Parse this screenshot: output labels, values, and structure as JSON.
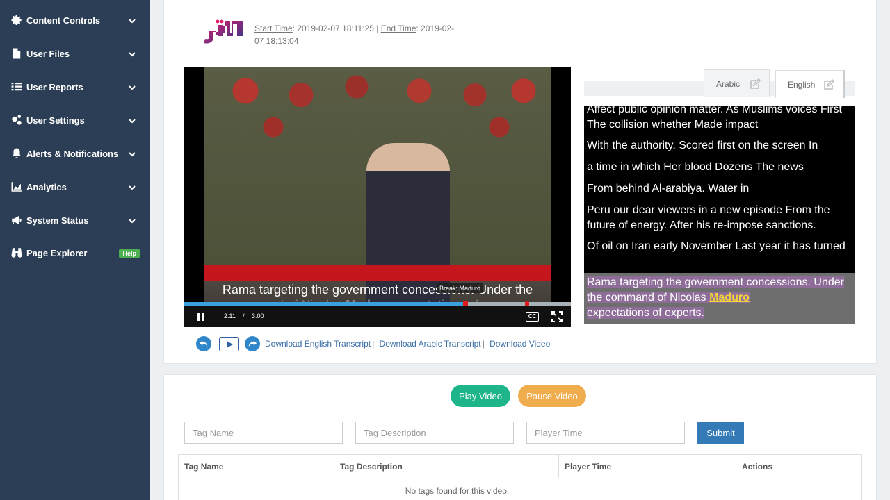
{
  "sidebar": {
    "items": [
      {
        "label": "Content Controls",
        "icon": "gear-icon"
      },
      {
        "label": "User Files",
        "icon": "file-icon"
      },
      {
        "label": "User Reports",
        "icon": "list-icon"
      },
      {
        "label": "User Settings",
        "icon": "gears-icon"
      },
      {
        "label": "Alerts & Notifications",
        "icon": "bell-icon"
      },
      {
        "label": "Analytics",
        "icon": "area-chart-icon"
      },
      {
        "label": "System Status",
        "icon": "megaphone-icon"
      },
      {
        "label": "Page Explorer",
        "icon": "binoculars-icon",
        "badge": "Help"
      }
    ]
  },
  "header": {
    "logo_text": "العربية",
    "start_label": "Start Time",
    "start_value": ": 2019-02-07 18:11:25 |",
    "end_label": "End Time",
    "end_value": ": 2019-02-07 18:13:04"
  },
  "player": {
    "subtitle_line1": "Rama targeting the government concessions. Under the",
    "subtitle_line2_a": "command of Nicolas ",
    "subtitle_line2_kw": "Maduro",
    "subtitle_line2_b": " expectations of experts.",
    "break_tooltip": "Break: Maduro",
    "current_time": "2:11",
    "time_separator": "/",
    "duration": "3:00",
    "cc_label": "CC",
    "progress_fraction": 0.728,
    "break_marker_fraction": 0.886
  },
  "links": {
    "english_transcript": "Download English Transcript",
    "arabic_transcript": "Download Arabic Transcript",
    "video": "Download Video",
    "separator": "|"
  },
  "transcript_tabs": {
    "arabic": "Arabic",
    "english": "English"
  },
  "transcript": {
    "lines": [
      "Affect public opinion matter. As Muslims voices First The collision whether Made impact",
      "With the authority. Scored first on the screen In",
      "a time in which Her blood Dozens The news",
      "From behind Al-arabiya. Water in",
      "Peru our dear viewers in a new episode From the future of energy. After his re-impose sanctions.",
      "Of oil on Iran early November Last year it has turned"
    ],
    "active_a": "Rama targeting the government concessions. Under the command of Nicolas ",
    "active_kw": "Maduro",
    "active_b": "expectations of experts."
  },
  "actions": {
    "play_video": "Play Video",
    "pause_video": "Pause Video"
  },
  "tag_form": {
    "tag_name_placeholder": "Tag Name",
    "tag_description_placeholder": "Tag Description",
    "player_time_placeholder": "Player Time",
    "submit": "Submit"
  },
  "tag_table": {
    "columns": [
      "Tag Name",
      "Tag Description",
      "Player Time",
      "Actions"
    ],
    "empty_message": "No tags found for this video."
  },
  "colors": {
    "sidebar_bg": "#2c3e55",
    "accent_blue": "#337ab7",
    "play_green": "#1fb58a",
    "pause_orange": "#f0ad4e",
    "keyword_yellow": "#f2d43a"
  }
}
